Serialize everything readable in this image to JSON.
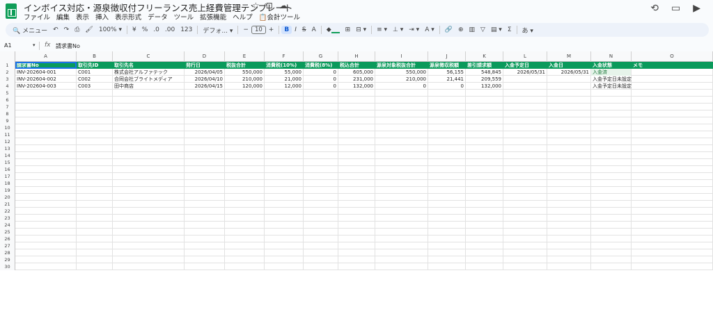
{
  "doc": {
    "title": "インボイス対応・源泉徴収付フリーランス売上経費管理テンプレート"
  },
  "menu": [
    "ファイル",
    "編集",
    "表示",
    "挿入",
    "表示形式",
    "データ",
    "ツール",
    "拡張機能",
    "ヘルプ",
    "会計ツール"
  ],
  "toolbar": {
    "search": "メニュー",
    "zoom": "100%",
    "currency": "¥",
    "percent": "%",
    "decimal_dec": ".0",
    "decimal_inc": ".00",
    "format_123": "123",
    "font": "デフォ...",
    "font_size": "10",
    "bold": "B",
    "italic": "I",
    "strike": "S",
    "text_color": "A",
    "input_method": "あ"
  },
  "formula": {
    "cell_ref": "A1",
    "content": "請求書No"
  },
  "columns": [
    "A",
    "B",
    "C",
    "D",
    "E",
    "F",
    "G",
    "H",
    "I",
    "J",
    "K",
    "L",
    "M",
    "N",
    "O"
  ],
  "headers": [
    "請求書No",
    "取引先ID",
    "取引先名",
    "発行日",
    "税抜合計",
    "消費税(10%)",
    "消費税(8%)",
    "税込合計",
    "源泉対象税抜合計",
    "源泉徴収税額",
    "差引請求額",
    "入金予定日",
    "入金日",
    "入金状態",
    "メモ"
  ],
  "rows": [
    [
      "INV-202604-001",
      "C001",
      "株式会社アルファテック",
      "2026/04/05",
      "550,000",
      "55,000",
      "0",
      "605,000",
      "550,000",
      "56,155",
      "548,845",
      "2026/05/31",
      "2026/05/31",
      "入金済",
      ""
    ],
    [
      "INV-202604-002",
      "C002",
      "合同会社ブライトメディア",
      "2026/04/10",
      "210,000",
      "21,000",
      "0",
      "231,000",
      "210,000",
      "21,441",
      "209,559",
      "",
      "",
      "入金予定日未設定",
      ""
    ],
    [
      "INV-202604-003",
      "C003",
      "田中商店",
      "2026/04/15",
      "120,000",
      "12,000",
      "0",
      "132,000",
      "0",
      "0",
      "132,000",
      "",
      "",
      "入金予定日未設定",
      ""
    ]
  ],
  "row_numbers": [
    "1",
    "2",
    "3",
    "4",
    "5",
    "6",
    "7",
    "8",
    "9",
    "10",
    "11",
    "12",
    "13",
    "14",
    "15",
    "16",
    "17",
    "18",
    "19",
    "20",
    "21",
    "22",
    "23",
    "24",
    "25",
    "26",
    "27",
    "28",
    "29",
    "30"
  ]
}
